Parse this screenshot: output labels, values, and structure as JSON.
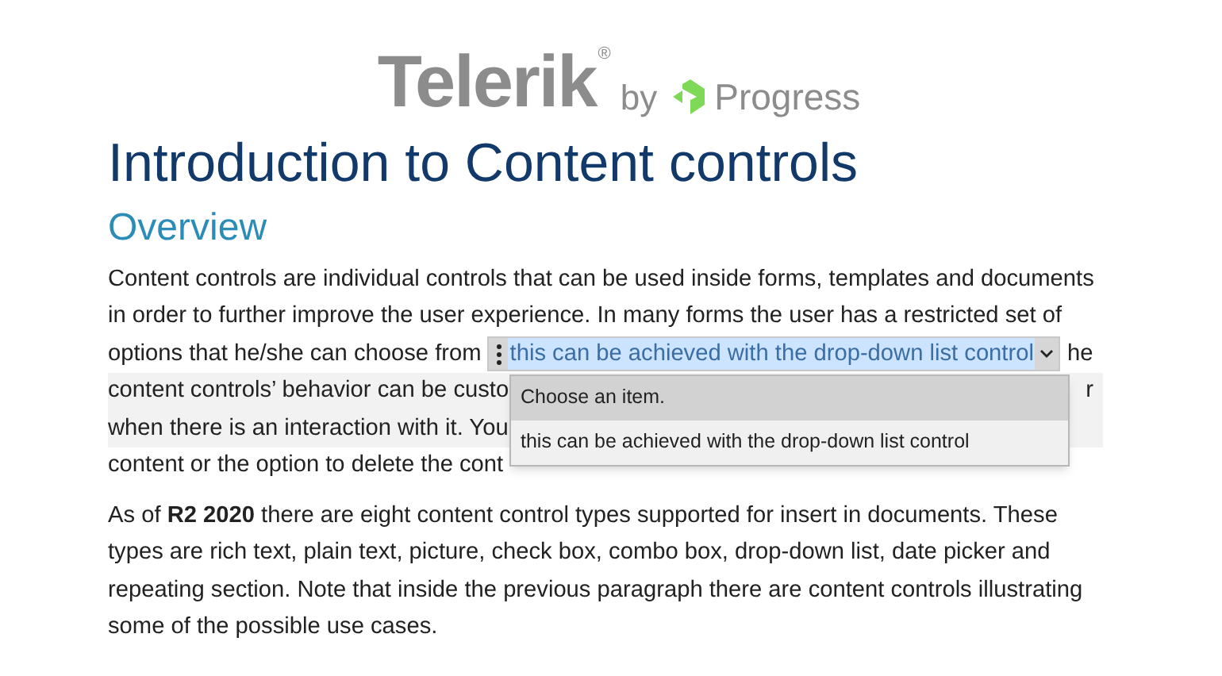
{
  "logo": {
    "brand": "Telerik",
    "mark": "®",
    "by": "by",
    "company": "Progress"
  },
  "title": "Introduction to Content controls",
  "heading": "Overview",
  "paragraph_1": {
    "lines_before": [
      "Content controls are individual controls that can be used inside forms, templates and documents",
      "in order to further improve the user experience. In many forms the user has a restricted set of"
    ],
    "line_3_before": "options that he/she can choose from",
    "dropdown_control": {
      "value": "this can be achieved with the drop-down list control",
      "expanded": true,
      "options": [
        {
          "label": "Choose an item.",
          "highlighted": true
        },
        {
          "label": "this can be achieved with the drop-down list control",
          "highlighted": false
        }
      ]
    },
    "line_3_after": "he",
    "lines_after": [
      "content controls’ behavior can be custo",
      "when there is an interaction with it. You",
      "content or the option to delete the cont"
    ],
    "line_4_end": "r"
  },
  "paragraph_2": "As of **R2 2020** there are eight content control types supported for insert in documents. These types are rich text, plain text, picture, check box, combo box, drop-down list, date picker and repeating section. Note that inside the previous paragraph there are content controls illustrating some of the possible use cases."
}
